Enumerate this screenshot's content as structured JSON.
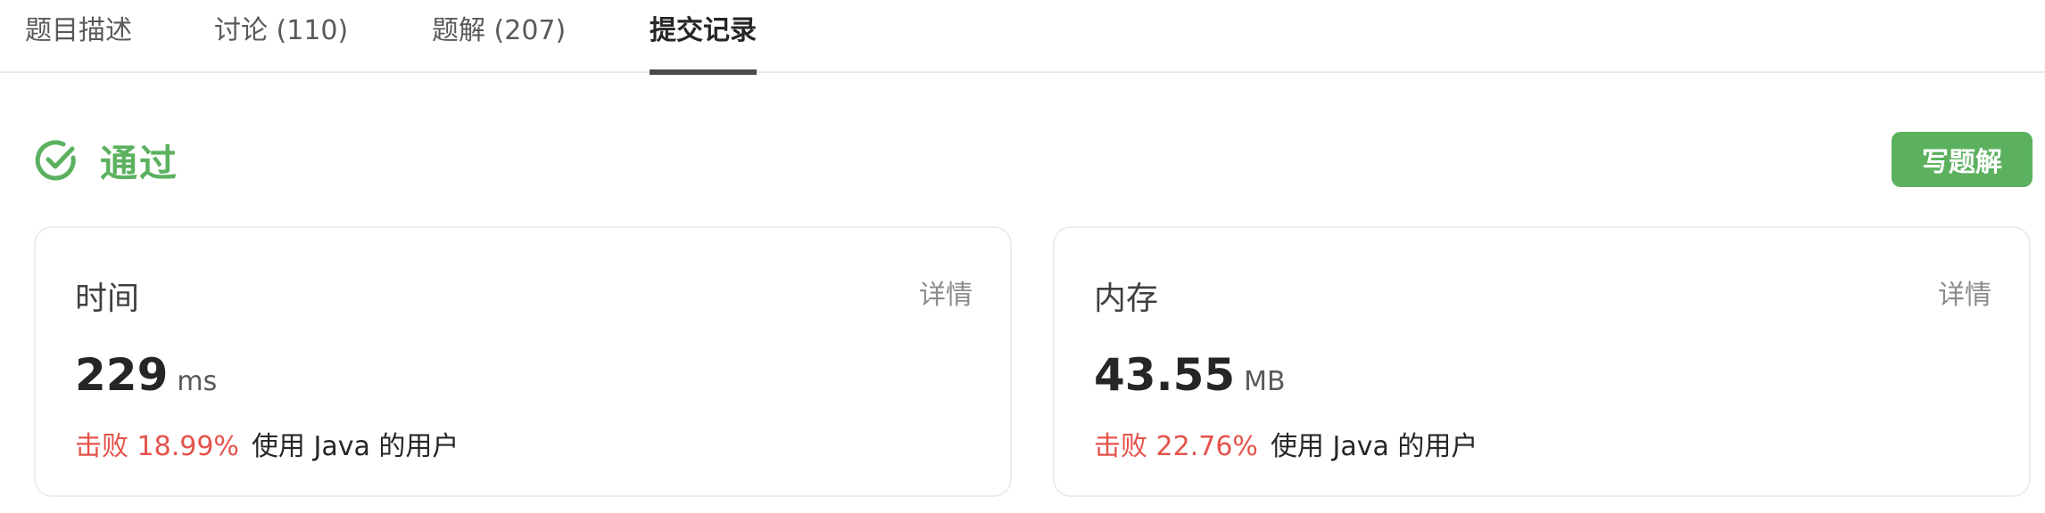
{
  "tabs": [
    {
      "label": "题目描述"
    },
    {
      "label": "讨论 (110)"
    },
    {
      "label": "题解 (207)"
    },
    {
      "label": "提交记录"
    }
  ],
  "active_tab": "提交记录",
  "status": {
    "label": "通过",
    "icon": "check-circle-icon",
    "color": "#5cb15f"
  },
  "write_solution_button": "写题解",
  "time_card": {
    "title": "时间",
    "detail": "详情",
    "value": "229",
    "unit": "ms",
    "beat_label": "击败 18.99%",
    "beat_rest": "使用 Java 的用户"
  },
  "memory_card": {
    "title": "内存",
    "detail": "详情",
    "value": "43.55",
    "unit": "MB",
    "beat_label": "击败 22.76%",
    "beat_rest": "使用 Java 的用户"
  },
  "colors": {
    "accent_green": "#5cb15f",
    "beat_red": "#e5534b"
  }
}
